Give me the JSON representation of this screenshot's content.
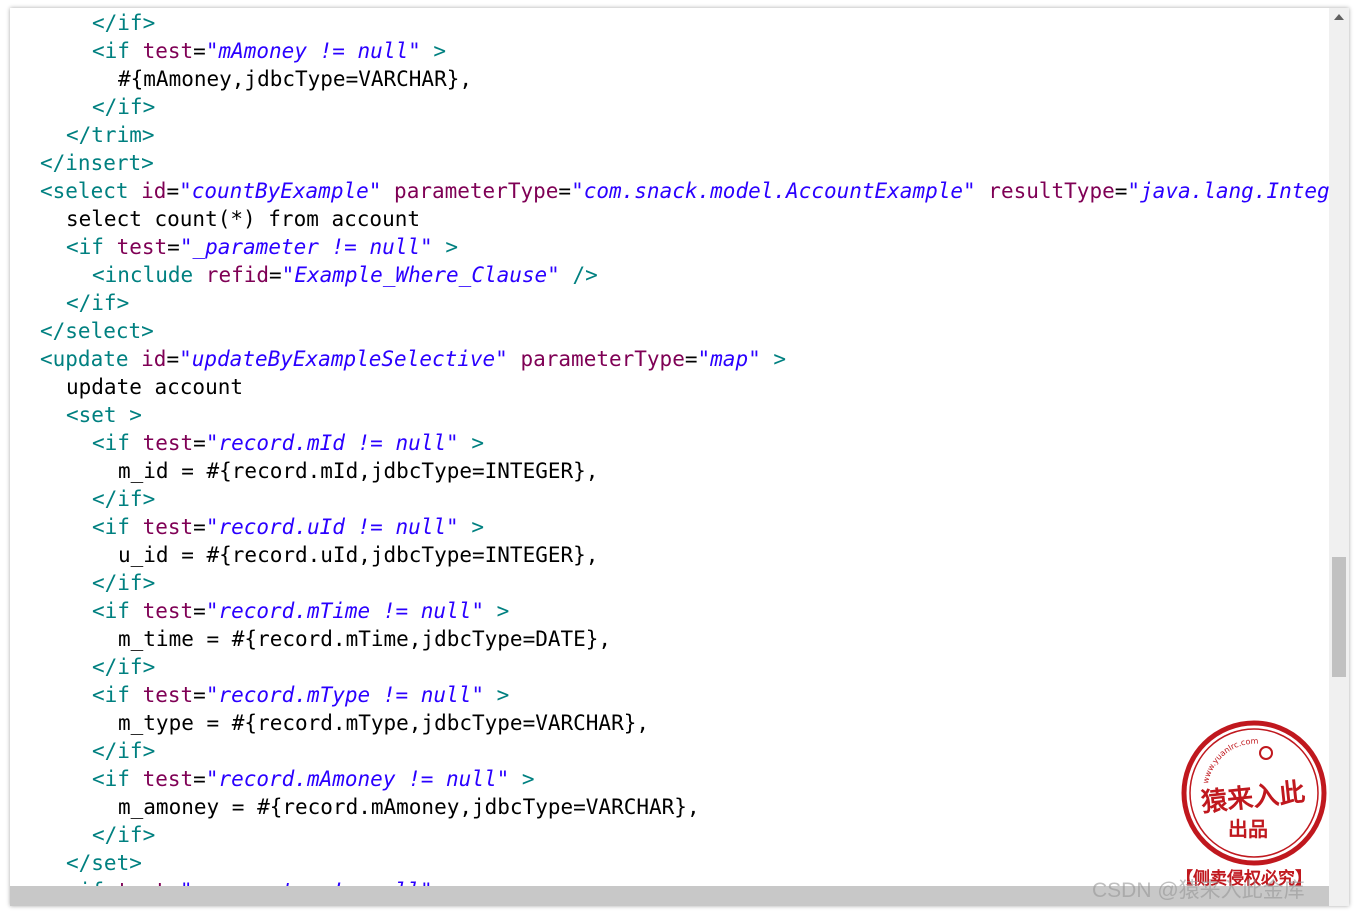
{
  "code_lines": [
    {
      "indent": 3,
      "parts": [
        {
          "c": "tag",
          "t": "</if>"
        }
      ]
    },
    {
      "indent": 3,
      "parts": [
        {
          "c": "tag",
          "t": "<if "
        },
        {
          "c": "attr",
          "t": "test"
        },
        {
          "c": "txt",
          "t": "="
        },
        {
          "c": "val",
          "t": "\"mAmoney != null\""
        },
        {
          "c": "tag",
          "t": " >"
        }
      ]
    },
    {
      "indent": 4,
      "parts": [
        {
          "c": "txt",
          "t": "#{mAmoney,jdbcType=VARCHAR},"
        }
      ]
    },
    {
      "indent": 3,
      "parts": [
        {
          "c": "tag",
          "t": "</if>"
        }
      ]
    },
    {
      "indent": 2,
      "parts": [
        {
          "c": "tag",
          "t": "</trim>"
        }
      ]
    },
    {
      "indent": 1,
      "parts": [
        {
          "c": "tag",
          "t": "</insert>"
        }
      ]
    },
    {
      "indent": 1,
      "parts": [
        {
          "c": "tag",
          "t": "<select "
        },
        {
          "c": "attr",
          "t": "id"
        },
        {
          "c": "txt",
          "t": "="
        },
        {
          "c": "val",
          "t": "\"countByExample\""
        },
        {
          "c": "attr",
          "t": " parameterType"
        },
        {
          "c": "txt",
          "t": "="
        },
        {
          "c": "val",
          "t": "\"com.snack.model.AccountExample\""
        },
        {
          "c": "attr",
          "t": " resultType"
        },
        {
          "c": "txt",
          "t": "="
        },
        {
          "c": "val",
          "t": "\"java.lang.Integer\""
        },
        {
          "c": "tag",
          "t": " >"
        }
      ]
    },
    {
      "indent": 2,
      "parts": [
        {
          "c": "txt",
          "t": "select count(*) from account"
        }
      ]
    },
    {
      "indent": 2,
      "parts": [
        {
          "c": "tag",
          "t": "<if "
        },
        {
          "c": "attr",
          "t": "test"
        },
        {
          "c": "txt",
          "t": "="
        },
        {
          "c": "val",
          "t": "\"_parameter != null\""
        },
        {
          "c": "tag",
          "t": " >"
        }
      ]
    },
    {
      "indent": 3,
      "parts": [
        {
          "c": "tag",
          "t": "<include "
        },
        {
          "c": "attr",
          "t": "refid"
        },
        {
          "c": "txt",
          "t": "="
        },
        {
          "c": "val",
          "t": "\"Example_Where_Clause\""
        },
        {
          "c": "tag",
          "t": " />"
        }
      ]
    },
    {
      "indent": 2,
      "parts": [
        {
          "c": "tag",
          "t": "</if>"
        }
      ]
    },
    {
      "indent": 1,
      "parts": [
        {
          "c": "tag",
          "t": "</select>"
        }
      ]
    },
    {
      "indent": 1,
      "parts": [
        {
          "c": "tag",
          "t": "<update "
        },
        {
          "c": "attr",
          "t": "id"
        },
        {
          "c": "txt",
          "t": "="
        },
        {
          "c": "val",
          "t": "\"updateByExampleSelective\""
        },
        {
          "c": "attr",
          "t": " parameterType"
        },
        {
          "c": "txt",
          "t": "="
        },
        {
          "c": "val",
          "t": "\"map\""
        },
        {
          "c": "tag",
          "t": " >"
        }
      ]
    },
    {
      "indent": 2,
      "parts": [
        {
          "c": "txt",
          "t": "update account"
        }
      ]
    },
    {
      "indent": 2,
      "parts": [
        {
          "c": "tag",
          "t": "<set >"
        }
      ]
    },
    {
      "indent": 3,
      "parts": [
        {
          "c": "tag",
          "t": "<if "
        },
        {
          "c": "attr",
          "t": "test"
        },
        {
          "c": "txt",
          "t": "="
        },
        {
          "c": "val",
          "t": "\"record.mId != null\""
        },
        {
          "c": "tag",
          "t": " >"
        }
      ]
    },
    {
      "indent": 4,
      "parts": [
        {
          "c": "txt",
          "t": "m_id = #{record.mId,jdbcType=INTEGER},"
        }
      ]
    },
    {
      "indent": 3,
      "parts": [
        {
          "c": "tag",
          "t": "</if>"
        }
      ]
    },
    {
      "indent": 3,
      "parts": [
        {
          "c": "tag",
          "t": "<if "
        },
        {
          "c": "attr",
          "t": "test"
        },
        {
          "c": "txt",
          "t": "="
        },
        {
          "c": "val",
          "t": "\"record.uId != null\""
        },
        {
          "c": "tag",
          "t": " >"
        }
      ]
    },
    {
      "indent": 4,
      "parts": [
        {
          "c": "txt",
          "t": "u_id = #{record.uId,jdbcType=INTEGER},"
        }
      ]
    },
    {
      "indent": 3,
      "parts": [
        {
          "c": "tag",
          "t": "</if>"
        }
      ]
    },
    {
      "indent": 3,
      "parts": [
        {
          "c": "tag",
          "t": "<if "
        },
        {
          "c": "attr",
          "t": "test"
        },
        {
          "c": "txt",
          "t": "="
        },
        {
          "c": "val",
          "t": "\"record.mTime != null\""
        },
        {
          "c": "tag",
          "t": " >"
        }
      ]
    },
    {
      "indent": 4,
      "parts": [
        {
          "c": "txt",
          "t": "m_time = #{record.mTime,jdbcType=DATE},"
        }
      ]
    },
    {
      "indent": 3,
      "parts": [
        {
          "c": "tag",
          "t": "</if>"
        }
      ]
    },
    {
      "indent": 3,
      "parts": [
        {
          "c": "tag",
          "t": "<if "
        },
        {
          "c": "attr",
          "t": "test"
        },
        {
          "c": "txt",
          "t": "="
        },
        {
          "c": "val",
          "t": "\"record.mType != null\""
        },
        {
          "c": "tag",
          "t": " >"
        }
      ]
    },
    {
      "indent": 4,
      "parts": [
        {
          "c": "txt",
          "t": "m_type = #{record.mType,jdbcType=VARCHAR},"
        }
      ]
    },
    {
      "indent": 3,
      "parts": [
        {
          "c": "tag",
          "t": "</if>"
        }
      ]
    },
    {
      "indent": 3,
      "parts": [
        {
          "c": "tag",
          "t": "<if "
        },
        {
          "c": "attr",
          "t": "test"
        },
        {
          "c": "txt",
          "t": "="
        },
        {
          "c": "val",
          "t": "\"record.mAmoney != null\""
        },
        {
          "c": "tag",
          "t": " >"
        }
      ]
    },
    {
      "indent": 4,
      "parts": [
        {
          "c": "txt",
          "t": "m_amoney = #{record.mAmoney,jdbcType=VARCHAR},"
        }
      ]
    },
    {
      "indent": 3,
      "parts": [
        {
          "c": "tag",
          "t": "</if>"
        }
      ]
    },
    {
      "indent": 2,
      "parts": [
        {
          "c": "tag",
          "t": "</set>"
        }
      ]
    },
    {
      "indent": 2,
      "parts": [
        {
          "c": "tag",
          "t": "<if "
        },
        {
          "c": "attr",
          "t": "test"
        },
        {
          "c": "txt",
          "t": "="
        },
        {
          "c": "val",
          "t": "\"_parameter != null\""
        },
        {
          "c": "tag",
          "t": " >"
        }
      ]
    }
  ],
  "stamp": {
    "url": "www.yuanlrc.com",
    "line1": "猿来入此",
    "line2": "出品",
    "caption": "【侧卖侵权必究】",
    "color": "#c0181e"
  },
  "watermark": "CSDN @猿来入此金库",
  "colors": {
    "tag": "#008080",
    "attribute": "#7f0055",
    "value": "#2a00ff",
    "text": "#000000"
  }
}
